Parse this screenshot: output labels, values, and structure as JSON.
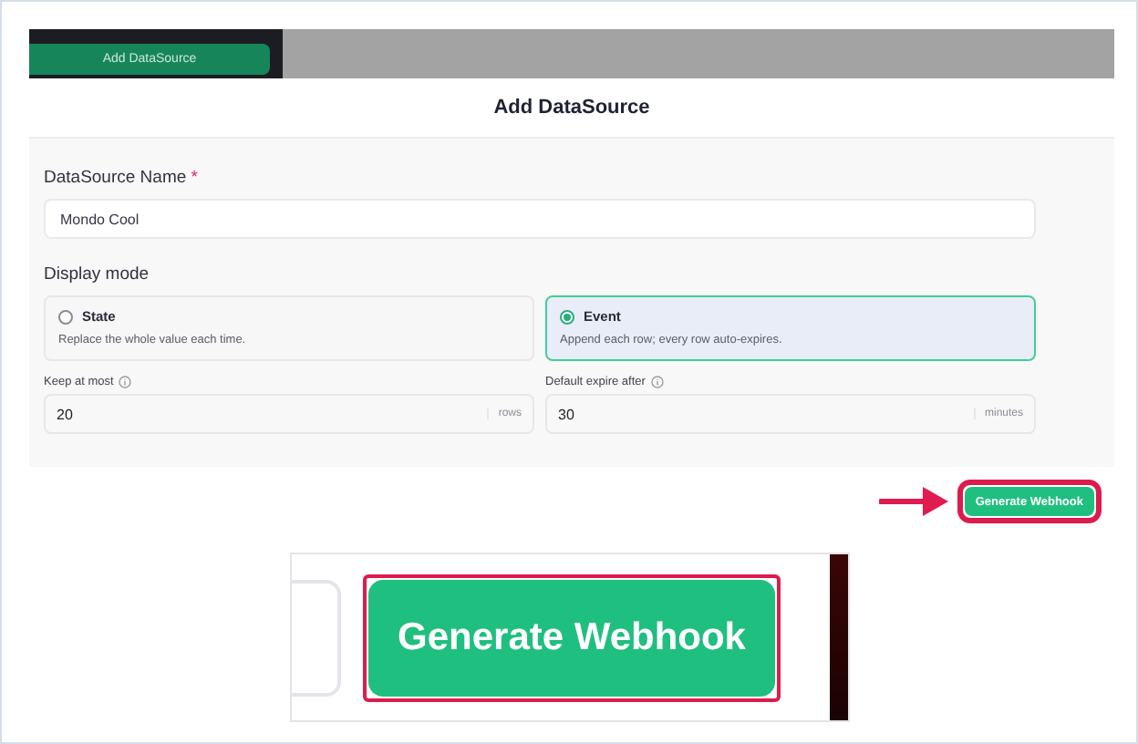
{
  "background_app": {
    "button": "Add DataSource"
  },
  "dialog": {
    "title": "Add DataSource",
    "name_field": {
      "label": "DataSource Name",
      "required_mark": "*",
      "value": "Mondo Cool"
    },
    "display_mode": {
      "label": "Display mode",
      "options": [
        {
          "title": "State",
          "description": "Replace the whole value each time.",
          "selected": false
        },
        {
          "title": "Event",
          "description": "Append each row; every row auto-expires.",
          "selected": true
        }
      ]
    },
    "limits": [
      {
        "label": "Keep at most",
        "value": "20",
        "unit": "rows"
      },
      {
        "label": "Default expire after",
        "value": "30",
        "unit": "minutes"
      }
    ],
    "primary_button": {
      "label": "Generate Webhook",
      "highlighted": true
    }
  },
  "zoom_inset": {
    "button": "Generate Webhook",
    "highlighted": true
  }
}
